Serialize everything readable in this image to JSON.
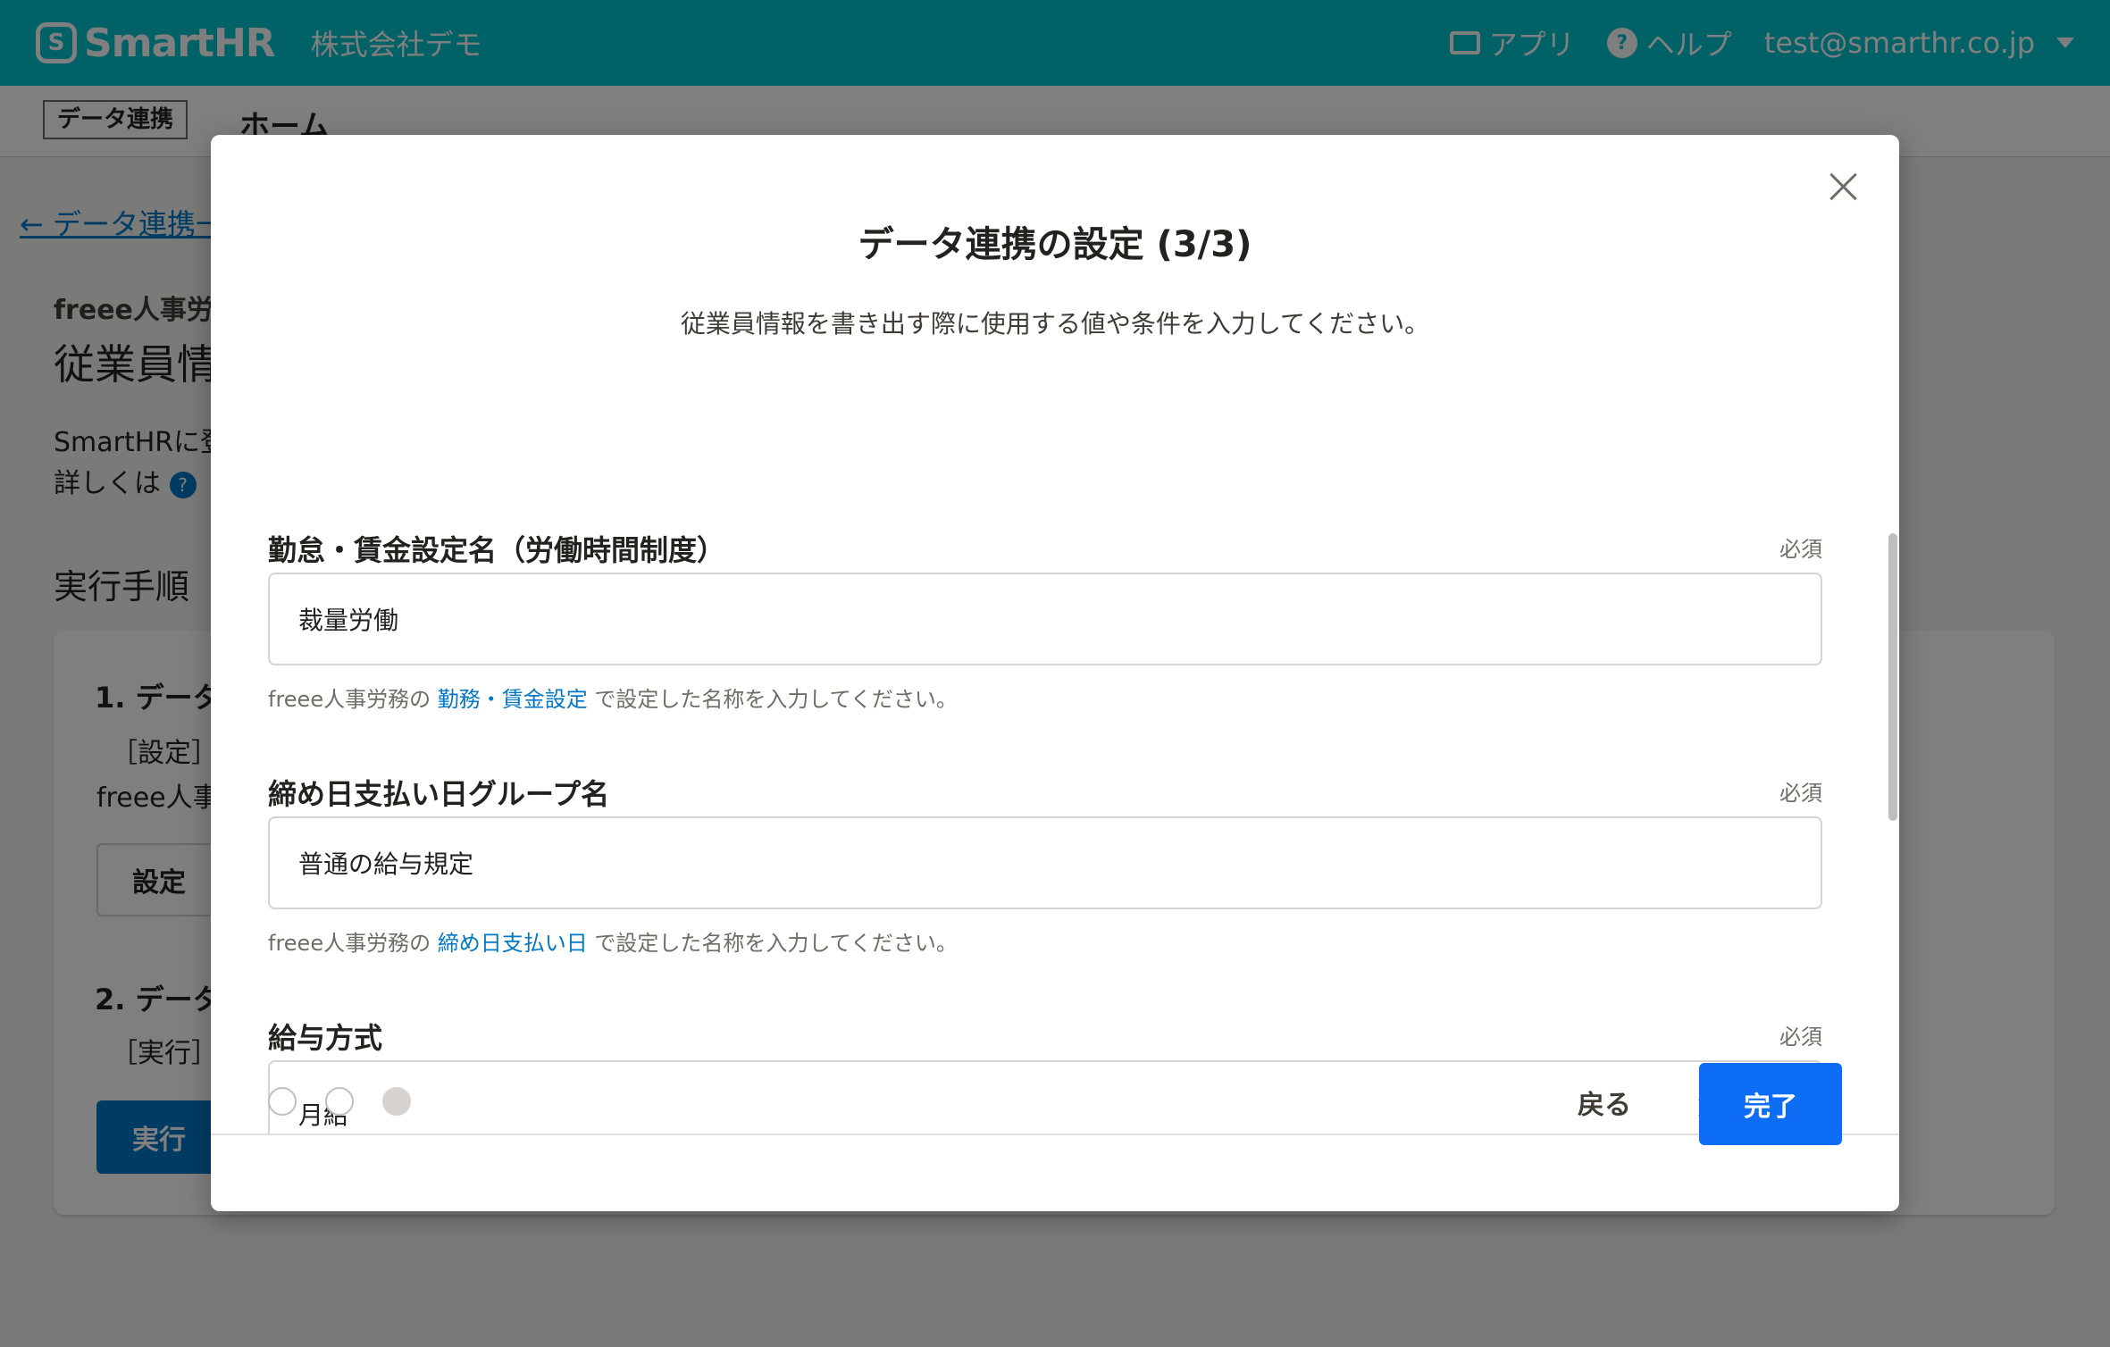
{
  "header": {
    "logo_mark": "S",
    "logo_text": "SmartHR",
    "company": "株式会社デモ",
    "apps_label": "アプリ",
    "help_label": "ヘルプ",
    "help_mark": "?",
    "user_email": "test@smarthr.co.jp"
  },
  "subbar": {
    "tag": "データ連携",
    "home": "ホーム"
  },
  "background": {
    "back_link": "← データ連携一",
    "service_name": "freee人事労",
    "page_title": "従業員情",
    "intro_line1": "SmartHRに登",
    "intro_line2": "詳しくは",
    "help_mark": "?",
    "steps_heading": "実行手順",
    "step1_title": "1. データ",
    "step1_desc": "［設定］",
    "step1_desc2": "freee人事",
    "settings_button": "設定",
    "step2_title": "2. データ",
    "step2_desc": "［実行］",
    "run_button": "実行"
  },
  "modal": {
    "title": "データ連携の設定 (3/3)",
    "description": "従業員情報を書き出す際に使用する値や条件を入力してください。",
    "required_label": "必須",
    "fields": [
      {
        "label": "勤怠・賃金設定名（労働時間制度）",
        "value": "裁量労働",
        "hint_prefix": "freee人事労務の",
        "hint_link": "勤務・賃金設定",
        "hint_suffix": "で設定した名称を入力してください。"
      },
      {
        "label": "締め日支払い日グループ名",
        "value": "普通の給与規定",
        "hint_prefix": "freee人事労務の",
        "hint_link": "締め日支払い日",
        "hint_suffix": "で設定した名称を入力してください。"
      },
      {
        "label": "給与方式",
        "value": "月給"
      }
    ],
    "back_button": "戻る",
    "done_button": "完了",
    "step_count": 3,
    "current_step": 3
  },
  "colors": {
    "header_bg": "#00c4cc",
    "primary_button": "#0d6ef5",
    "link": "#0077c7"
  }
}
